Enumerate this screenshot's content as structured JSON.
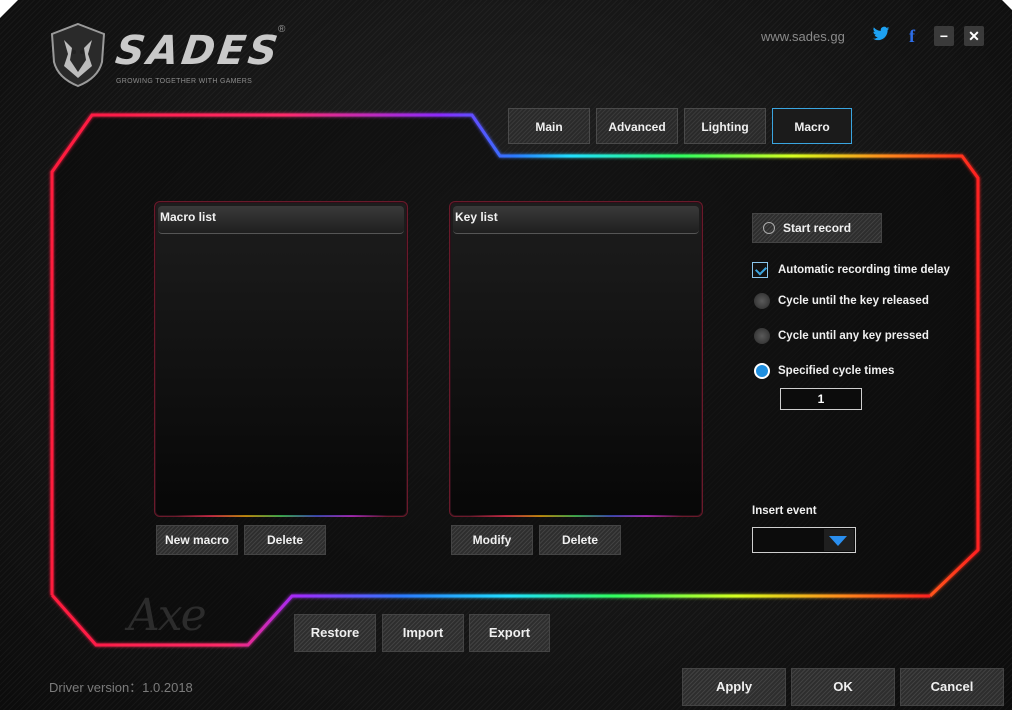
{
  "header": {
    "brand": "SADES",
    "registered": "®",
    "tagline": "GROWING TOGETHER WITH GAMERS",
    "website": "www.sades.gg",
    "twitter_icon": "twitter-icon",
    "facebook_icon": "facebook-icon",
    "minimize_label": "−",
    "close_label": "✕"
  },
  "tabs": [
    {
      "label": "Main",
      "active": false
    },
    {
      "label": "Advanced",
      "active": false
    },
    {
      "label": "Lighting",
      "active": false
    },
    {
      "label": "Macro",
      "active": true
    }
  ],
  "macro_list": {
    "title": "Macro list",
    "new_label": "New macro",
    "delete_label": "Delete"
  },
  "key_list": {
    "title": "Key list",
    "modify_label": "Modify",
    "delete_label": "Delete"
  },
  "record": {
    "start_label": "Start record",
    "auto_delay_label": "Automatic recording time delay",
    "auto_delay_checked": true,
    "cycle_release_label": "Cycle until the key released",
    "cycle_any_label": "Cycle until any key pressed",
    "specified_label": "Specified cycle times",
    "selected_mode": "specified",
    "cycle_times": "1",
    "insert_event_label": "Insert event",
    "insert_event_value": ""
  },
  "footer": {
    "restore_label": "Restore",
    "import_label": "Import",
    "export_label": "Export",
    "apply_label": "Apply",
    "ok_label": "OK",
    "cancel_label": "Cancel",
    "driver_version": "Driver version：1.0.2018",
    "model_watermark": "Axe"
  },
  "colors": {
    "accent": "#3aa5e0",
    "radio_selected": "#1f8fe0",
    "background": "#161616"
  }
}
